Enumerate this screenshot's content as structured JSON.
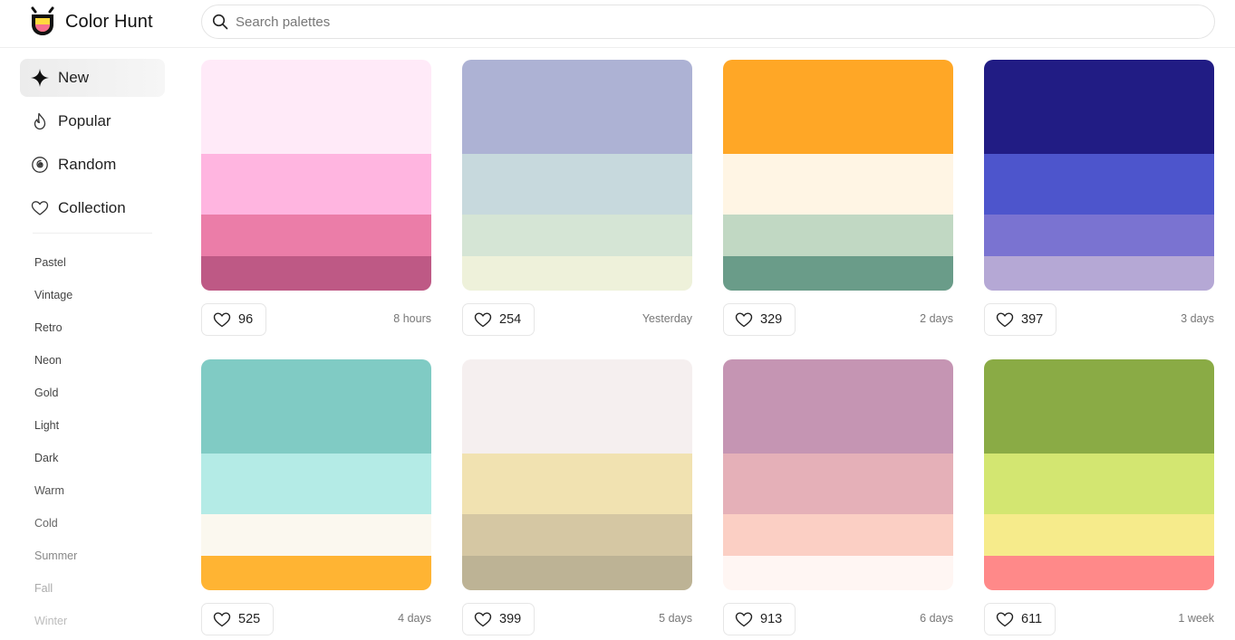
{
  "header": {
    "brand": "Color Hunt",
    "search_placeholder": "Search palettes"
  },
  "sidebar": {
    "nav": [
      {
        "label": "New",
        "icon": "sparkle-icon",
        "active": true
      },
      {
        "label": "Popular",
        "icon": "flame-icon",
        "active": false
      },
      {
        "label": "Random",
        "icon": "spiral-icon",
        "active": false
      },
      {
        "label": "Collection",
        "icon": "heart-icon",
        "active": false
      }
    ],
    "tags": [
      {
        "label": "Pastel",
        "color": "#444444"
      },
      {
        "label": "Vintage",
        "color": "#444444"
      },
      {
        "label": "Retro",
        "color": "#444444"
      },
      {
        "label": "Neon",
        "color": "#444444"
      },
      {
        "label": "Gold",
        "color": "#444444"
      },
      {
        "label": "Light",
        "color": "#444444"
      },
      {
        "label": "Dark",
        "color": "#444444"
      },
      {
        "label": "Warm",
        "color": "#555555"
      },
      {
        "label": "Cold",
        "color": "#666666"
      },
      {
        "label": "Summer",
        "color": "#888888"
      },
      {
        "label": "Fall",
        "color": "#aaaaaa"
      },
      {
        "label": "Winter",
        "color": "#bbbbbb"
      }
    ]
  },
  "palettes": [
    {
      "colors": [
        "#FFEAF8",
        "#FFB5E0",
        "#EB7DA8",
        "#BE5985"
      ],
      "likes": "96",
      "date": "8 hours"
    },
    {
      "colors": [
        "#ADB2D4",
        "#C7D9DD",
        "#D5E5D5",
        "#EEF1DA"
      ],
      "likes": "254",
      "date": "Yesterday"
    },
    {
      "colors": [
        "#FFA726",
        "#FFF5E4",
        "#C1D8C3",
        "#6A9C89"
      ],
      "likes": "329",
      "date": "2 days"
    },
    {
      "colors": [
        "#211C84",
        "#4D55CC",
        "#7A73D1",
        "#B5A8D5"
      ],
      "likes": "397",
      "date": "3 days"
    },
    {
      "colors": [
        "#80CBC4",
        "#B4EBE6",
        "#FBF8EF",
        "#FFB433"
      ],
      "likes": "525",
      "date": "4 days"
    },
    {
      "colors": [
        "#F5EFEF",
        "#F1E2B1",
        "#D5C7A3",
        "#BDB395"
      ],
      "likes": "399",
      "date": "5 days"
    },
    {
      "colors": [
        "#C595B3",
        "#E5B0B8",
        "#FBCFC4",
        "#FFF6F3"
      ],
      "likes": "913",
      "date": "6 days"
    },
    {
      "colors": [
        "#8AAB45",
        "#D3E671",
        "#F6EB8B",
        "#FF8989"
      ],
      "likes": "611",
      "date": "1 week"
    }
  ]
}
